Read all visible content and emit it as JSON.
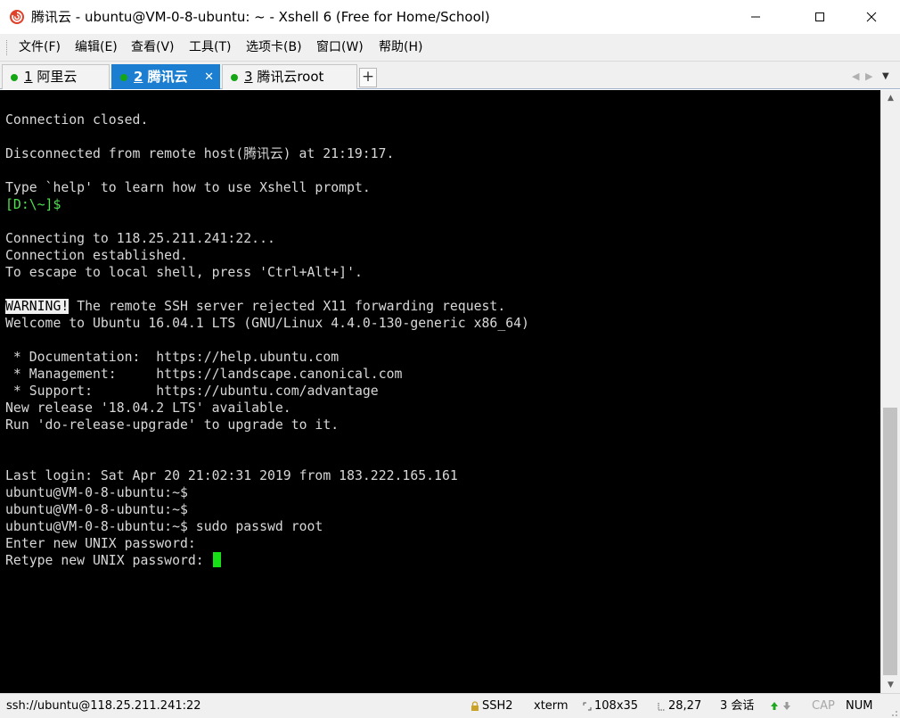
{
  "window": {
    "title": "腾讯云 - ubuntu@VM-0-8-ubuntu: ~ - Xshell 6 (Free for Home/School)"
  },
  "menu": [
    "文件(F)",
    "编辑(E)",
    "查看(V)",
    "工具(T)",
    "选项卡(B)",
    "窗口(W)",
    "帮助(H)"
  ],
  "tabs": [
    {
      "number": "1",
      "label": "阿里云",
      "active": false
    },
    {
      "number": "2",
      "label": "腾讯云",
      "active": true
    },
    {
      "number": "3",
      "label": "腾讯云root",
      "active": false
    }
  ],
  "tab_add_label": "+",
  "terminal": {
    "lines": [
      "Connection closed.",
      "",
      "Disconnected from remote host(腾讯云) at 21:19:17.",
      "",
      "Type `help' to learn how to use Xshell prompt.",
      "[D:\\~]$",
      "",
      "Connecting to 118.25.211.241:22...",
      "Connection established.",
      "To escape to local shell, press 'Ctrl+Alt+]'.",
      "",
      "WARNING!",
      "Welcome to Ubuntu 16.04.1 LTS (GNU/Linux 4.4.0-130-generic x86_64)",
      "",
      " * Documentation:  https://help.ubuntu.com",
      " * Management:     https://landscape.canonical.com",
      " * Support:        https://ubuntu.com/advantage",
      "New release '18.04.2 LTS' available.",
      "Run 'do-release-upgrade' to upgrade to it.",
      "",
      "",
      "Last login: Sat Apr 20 21:02:31 2019 from 183.222.165.161",
      "ubuntu@VM-0-8-ubuntu:~$",
      "ubuntu@VM-0-8-ubuntu:~$",
      "ubuntu@VM-0-8-ubuntu:~$ sudo passwd root",
      "Enter new UNIX password:",
      "Retype new UNIX password: "
    ],
    "warning_rest": " The remote SSH server rejected X11 forwarding request.",
    "local_prompt_line": 5,
    "warning_line": 11,
    "cursor_line": 26
  },
  "status": {
    "connection": "ssh://ubuntu@118.25.211.241:22",
    "protocol": "SSH2",
    "terminal_type": "xterm",
    "size": "108x35",
    "cursor_pos": "28,27",
    "sessions": "3 会话",
    "caps": "CAP",
    "num": "NUM"
  },
  "colors": {
    "active_tab": "#1b7ed1",
    "connected_dot": "#15a615",
    "prompt_green": "#4fe24f",
    "cursor": "#17e017",
    "terminal_bg": "#000000"
  }
}
